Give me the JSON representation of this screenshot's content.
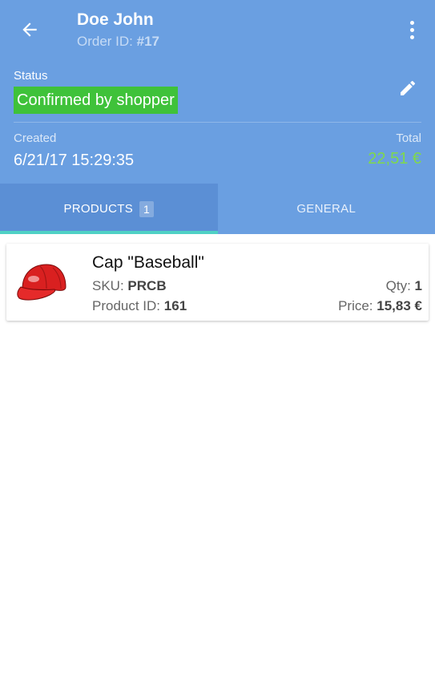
{
  "header": {
    "title": "Doe John",
    "order_id_label": "Order ID:",
    "order_id_value": "#17",
    "status_label": "Status",
    "status_value": "Confirmed by shopper",
    "created_label": "Created",
    "created_value": "6/21/17 15:29:35",
    "total_label": "Total",
    "total_value": "22,51 €",
    "icons": [
      "arrow-back-icon",
      "more-vert-icon",
      "pencil-icon"
    ]
  },
  "tabs": [
    {
      "label": "PRODUCTS",
      "badge": "1",
      "active": true
    },
    {
      "label": "GENERAL",
      "active": false
    }
  ],
  "products": [
    {
      "name": "Cap \"Baseball\"",
      "sku_label": "SKU:",
      "sku": "PRCB",
      "id_label": "Product ID:",
      "id": "161",
      "qty_label": "Qty:",
      "qty": "1",
      "price_label": "Price:",
      "price": "15,83 €",
      "image": "red-cap-image"
    }
  ],
  "colors": {
    "header_bg": "#6a9fe1",
    "active_tab_bg": "#5b8fd5",
    "tab_indicator": "#4fd1c5",
    "status_badge": "#3fc23a",
    "total_value": "#7fd94b"
  }
}
